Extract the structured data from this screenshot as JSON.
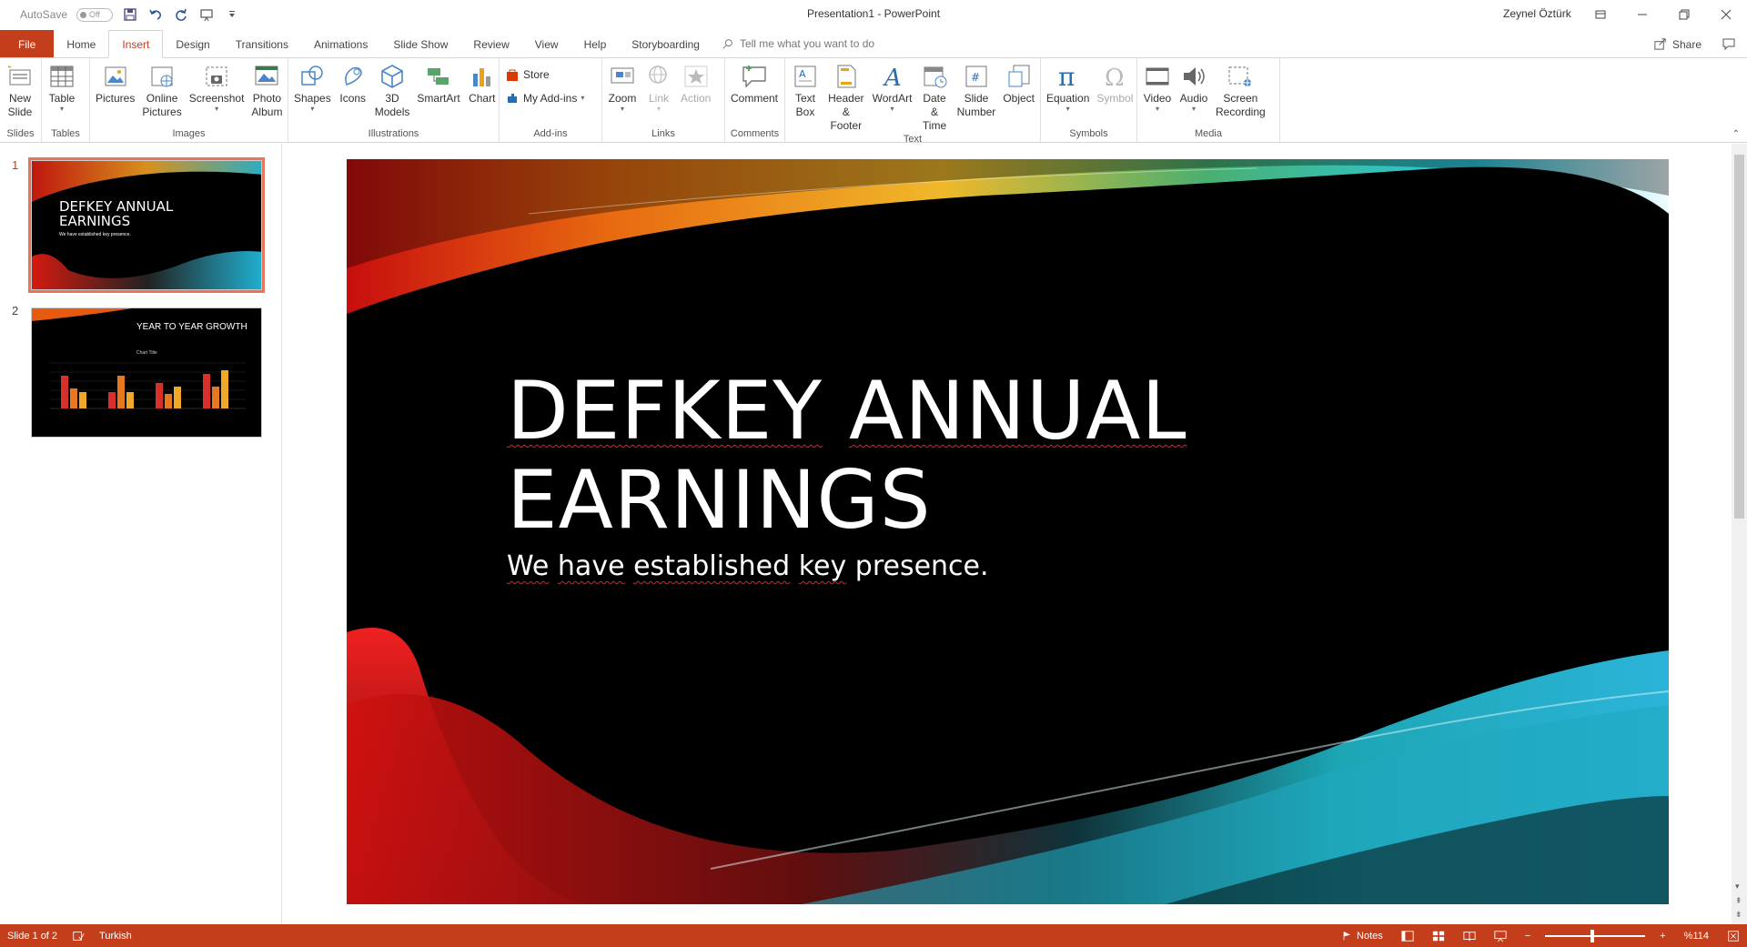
{
  "titlebar": {
    "autosave_label": "AutoSave",
    "autosave_state": "Off",
    "doc_title": "Presentation1  -  PowerPoint",
    "user_name": "Zeynel Öztürk"
  },
  "tabs": {
    "file": "File",
    "home": "Home",
    "insert": "Insert",
    "design": "Design",
    "transitions": "Transitions",
    "animations": "Animations",
    "slideshow": "Slide Show",
    "review": "Review",
    "view": "View",
    "help": "Help",
    "storyboarding": "Storyboarding",
    "tellme": "Tell me what you want to do",
    "share": "Share"
  },
  "ribbon": {
    "slides": {
      "label": "Slides",
      "new_slide_1": "New",
      "new_slide_2": "Slide"
    },
    "tables": {
      "label": "Tables",
      "table": "Table"
    },
    "images": {
      "label": "Images",
      "pictures": "Pictures",
      "online_1": "Online",
      "online_2": "Pictures",
      "screenshot": "Screenshot",
      "photo_1": "Photo",
      "photo_2": "Album"
    },
    "illustrations": {
      "label": "Illustrations",
      "shapes": "Shapes",
      "icons": "Icons",
      "models_1": "3D",
      "models_2": "Models",
      "smartart": "SmartArt",
      "chart": "Chart"
    },
    "addins": {
      "label": "Add-ins",
      "store": "Store",
      "my_addins": "My Add-ins"
    },
    "links": {
      "label": "Links",
      "zoom": "Zoom",
      "link": "Link",
      "action": "Action"
    },
    "comments": {
      "label": "Comments",
      "comment": "Comment"
    },
    "text": {
      "label": "Text",
      "textbox_1": "Text",
      "textbox_2": "Box",
      "header_1": "Header",
      "header_2": "& Footer",
      "wordart": "WordArt",
      "date_1": "Date &",
      "date_2": "Time",
      "slidenum_1": "Slide",
      "slidenum_2": "Number",
      "object": "Object"
    },
    "symbols": {
      "label": "Symbols",
      "equation": "Equation",
      "symbol": "Symbol"
    },
    "media": {
      "label": "Media",
      "video": "Video",
      "audio": "Audio",
      "screen_1": "Screen",
      "screen_2": "Recording"
    }
  },
  "thumbnails": [
    {
      "num": "1",
      "title": "DEFKEY ANNUAL EARNINGS",
      "subtitle": "We have established key presence."
    },
    {
      "num": "2",
      "title": "YEAR TO YEAR GROWTH",
      "chart_title": "Chart Title"
    }
  ],
  "slide": {
    "title_line1": "DEFKEY",
    "title_line1b": "ANNUAL",
    "title_line2": "EARNINGS",
    "sub_we": "We",
    "sub_have": "have",
    "sub_established": "established",
    "sub_key": "key",
    "sub_presence": "presence."
  },
  "status": {
    "slide_info": "Slide 1 of 2",
    "language": "Turkish",
    "notes": "Notes",
    "zoom": "%114"
  },
  "colors": {
    "accent": "#c43e1c",
    "status_bar": "#c43e1c",
    "thumb_selected": "#e8745a"
  }
}
